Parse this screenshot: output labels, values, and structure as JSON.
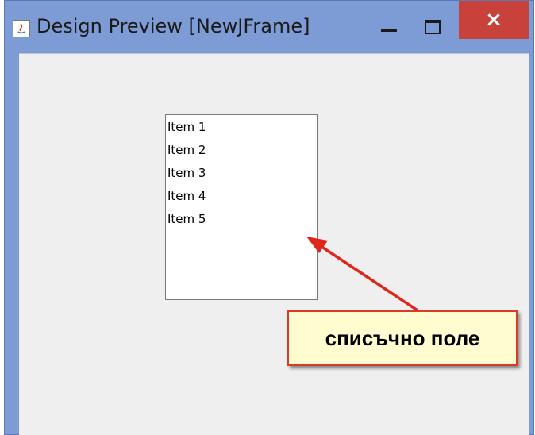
{
  "window": {
    "title": "Design Preview [NewJFrame]",
    "icon": "java-icon",
    "buttons": {
      "minimize": "minimize-icon",
      "maximize": "maximize-icon",
      "close": "×"
    },
    "colors": {
      "frame": "#7d9bd4",
      "close": "#c9413b",
      "content_bg": "#efeff0"
    }
  },
  "list": {
    "items": [
      "Item 1",
      "Item 2",
      "Item 3",
      "Item 4",
      "Item 5"
    ]
  },
  "annotation": {
    "label": "списъчно поле",
    "colors": {
      "arrow": "#e0251b",
      "box_bg": "#fffccf",
      "box_border": "#d93b2b"
    }
  }
}
